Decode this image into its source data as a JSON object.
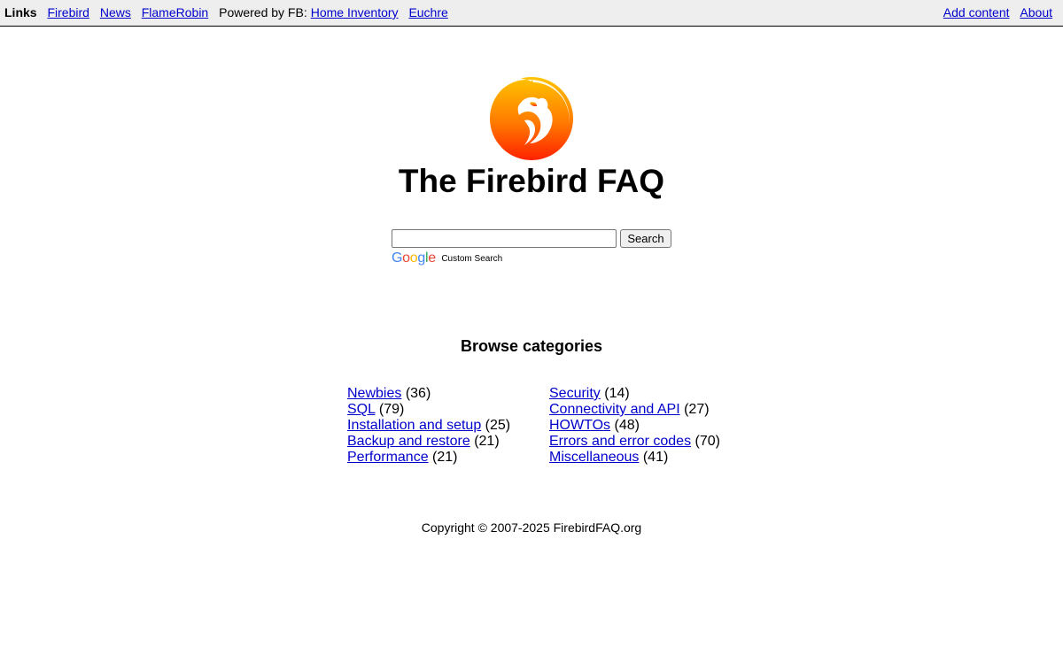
{
  "nav": {
    "links_label": "Links",
    "left_links": [
      {
        "label": "Firebird"
      },
      {
        "label": "News"
      },
      {
        "label": "FlameRobin"
      }
    ],
    "powered_label": "Powered by FB:",
    "powered_links": [
      {
        "label": "Home Inventory"
      },
      {
        "label": "Euchre"
      }
    ],
    "right_links": [
      {
        "label": "Add content"
      },
      {
        "label": "About"
      }
    ]
  },
  "header": {
    "logo_icon": "firebird-logo-icon",
    "title": "The Firebird FAQ"
  },
  "search": {
    "value": "",
    "button_label": "Search",
    "google_brand": [
      "G",
      "o",
      "o",
      "g",
      "l",
      "e"
    ],
    "custom_search_label": "Custom Search"
  },
  "browse": {
    "heading": "Browse categories",
    "left_column": [
      {
        "label": "Newbies",
        "count": "(36)"
      },
      {
        "label": "SQL",
        "count": "(79)"
      },
      {
        "label": "Installation and setup",
        "count": "(25)"
      },
      {
        "label": "Backup and restore",
        "count": "(21)"
      },
      {
        "label": "Performance",
        "count": "(21)"
      }
    ],
    "right_column": [
      {
        "label": "Security",
        "count": "(14)"
      },
      {
        "label": "Connectivity and API",
        "count": "(27)"
      },
      {
        "label": "HOWTOs",
        "count": "(48)"
      },
      {
        "label": "Errors and error codes",
        "count": "(70)"
      },
      {
        "label": "Miscellaneous",
        "count": "(41)"
      }
    ]
  },
  "footer": {
    "copyright": "Copyright © 2007-2025 FirebirdFAQ.org"
  },
  "colors": {
    "link": "#0000cc",
    "topbar_bg": "#eeeeee",
    "logo_top": "#ffb300",
    "logo_bottom": "#ff2a00"
  }
}
